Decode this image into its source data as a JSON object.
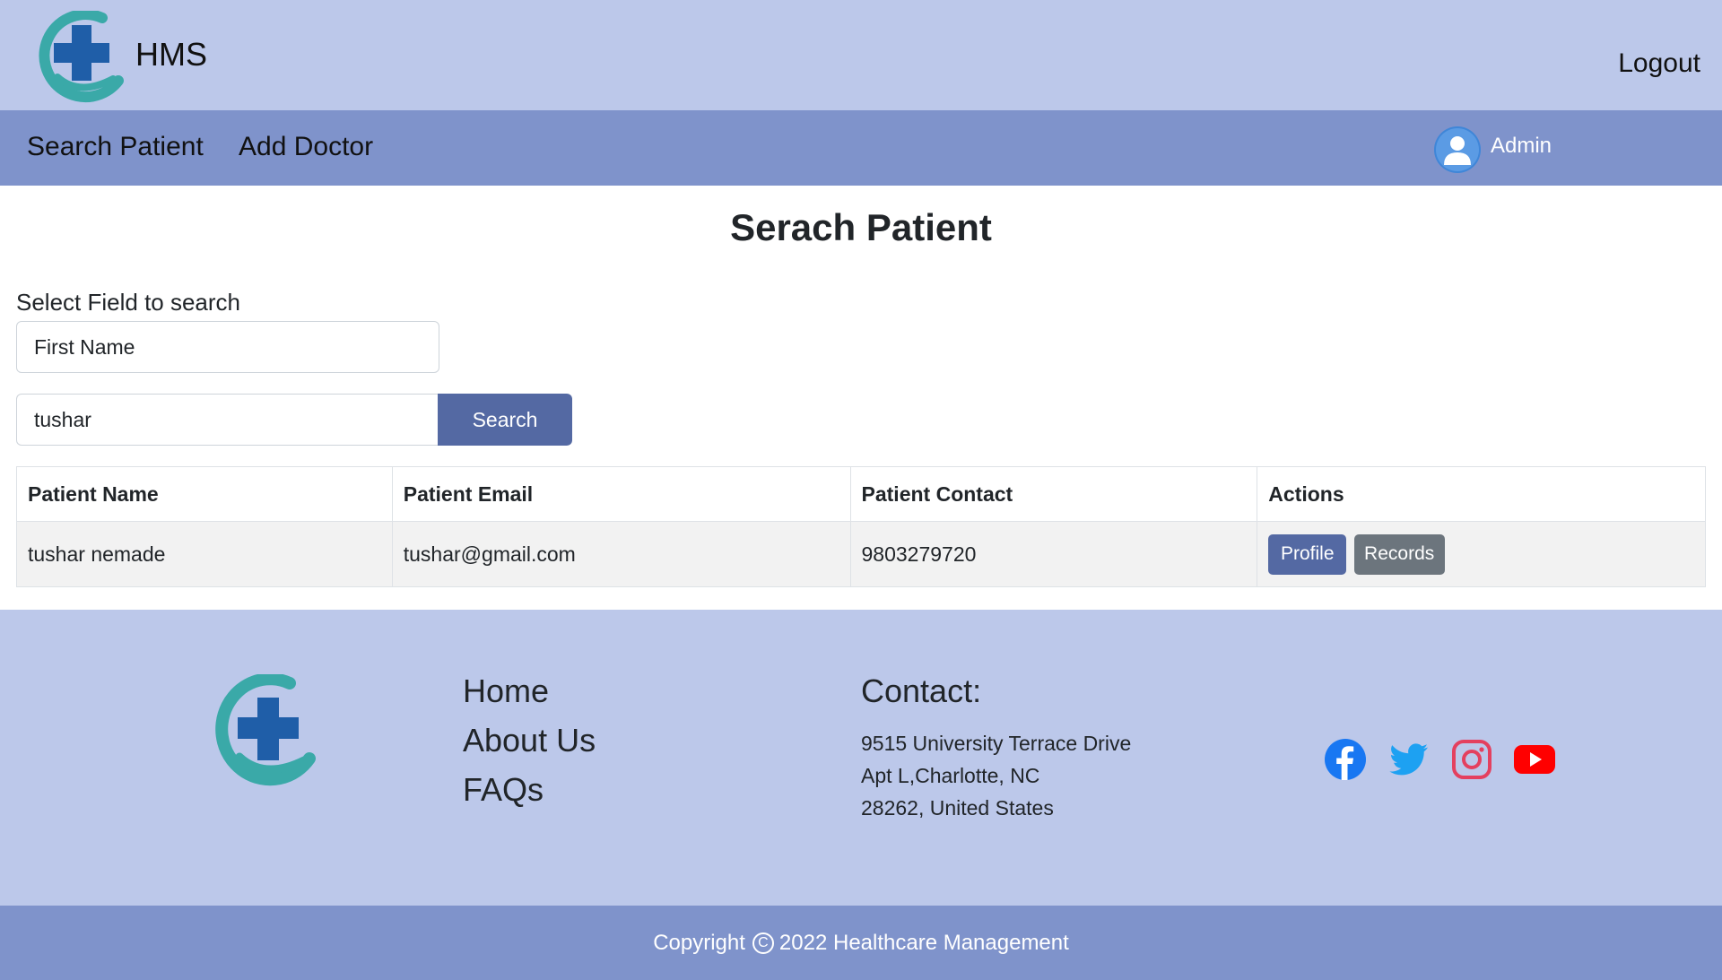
{
  "header": {
    "brand": "HMS",
    "logout_label": "Logout",
    "logo_icon": "hospital-cross-hand-logo"
  },
  "nav": {
    "items": [
      {
        "label": "Search Patient"
      },
      {
        "label": "Add Doctor"
      }
    ],
    "user_label": "Admin",
    "user_icon": "user-avatar-icon"
  },
  "main": {
    "title": "Serach Patient",
    "field_label": "Select Field to search",
    "field_value": "First Name",
    "search_value": "tushar",
    "search_button": "Search",
    "table": {
      "headers": [
        "Patient Name",
        "Patient Email",
        "Patient Contact",
        "Actions"
      ],
      "rows": [
        {
          "name": "tushar nemade",
          "email": "tushar@gmail.com",
          "contact": "9803279720",
          "profile_label": "Profile",
          "records_label": "Records"
        }
      ]
    }
  },
  "footer": {
    "links": [
      {
        "label": "Home"
      },
      {
        "label": "About Us"
      },
      {
        "label": "FAQs"
      }
    ],
    "contact_title": "Contact:",
    "address_lines": [
      "9515 University Terrace Drive",
      "Apt L,Charlotte, NC",
      "28262, United States"
    ],
    "social_icons": [
      "facebook-icon",
      "twitter-icon",
      "instagram-icon",
      "youtube-icon"
    ],
    "copyright_prefix": "Copyright",
    "copyright_symbol": "C",
    "copyright_text": "2022 Healthcare Management"
  },
  "colors": {
    "header_bg": "#bcc8ea",
    "nav_bg": "#7f93cb",
    "primary_button": "#5469a3",
    "secondary_button": "#6c757d",
    "logo_teal": "#3aa9a8",
    "logo_blue": "#1f5ea8",
    "facebook": "#1877f2",
    "twitter": "#1da1f2",
    "instagram": "#e4405f",
    "youtube": "#ff0000"
  }
}
